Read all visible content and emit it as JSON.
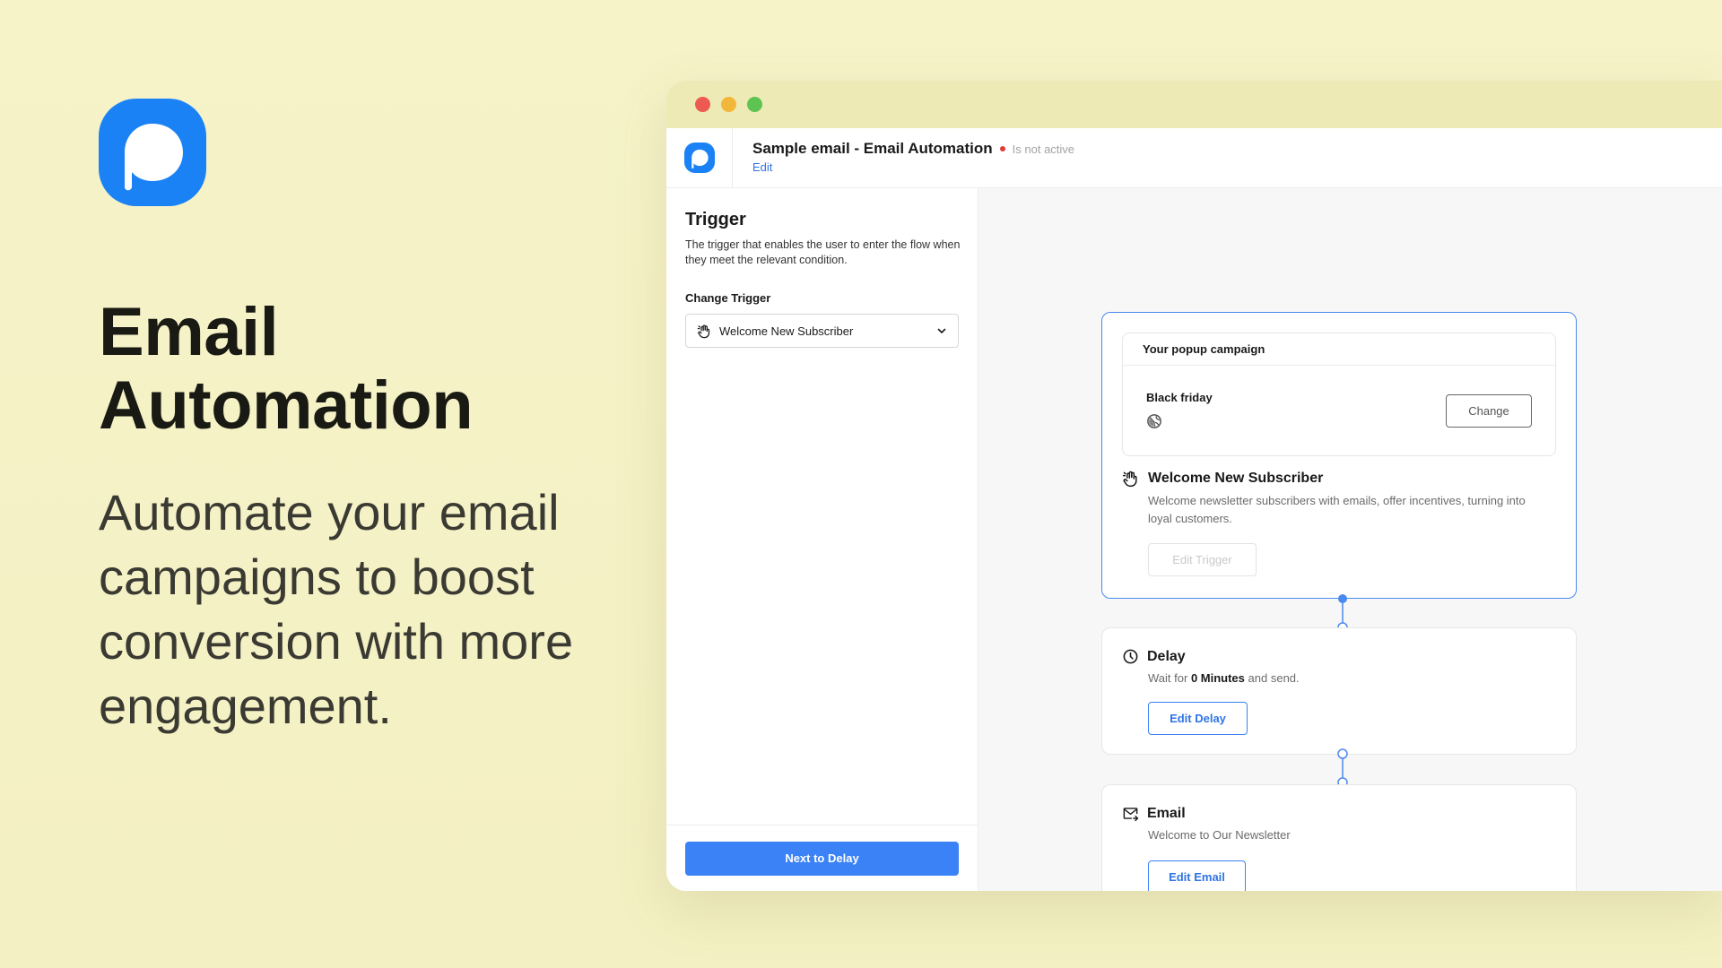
{
  "hero": {
    "title_line1": "Email",
    "title_line2": "Automation",
    "subtitle": "Automate your email campaigns to boost conversion with more engagement."
  },
  "colors": {
    "background": "#f6f3c9",
    "brand_blue": "#1b82f6",
    "accent": "#3b82f6",
    "status_inactive": "#e53935"
  },
  "window": {
    "controls": [
      "close-red",
      "minimize-yellow",
      "maximize-green"
    ]
  },
  "header": {
    "title": "Sample email - Email Automation",
    "status": "Is not active",
    "edit_label": "Edit"
  },
  "sidebar": {
    "title": "Trigger",
    "description": "The trigger that enables the user to enter the flow when they meet the relevant condition.",
    "change_label": "Change Trigger",
    "selected_trigger": "Welcome New Subscriber",
    "next_button": "Next to Delay"
  },
  "flow": {
    "trigger": {
      "popup_header": "Your popup campaign",
      "popup_name": "Black friday",
      "change_button": "Change",
      "title": "Welcome New Subscriber",
      "description": "Welcome newsletter subscribers with emails, offer incentives, turning into loyal customers.",
      "edit_button": "Edit Trigger"
    },
    "delay": {
      "title": "Delay",
      "desc_prefix": "Wait for",
      "desc_value": "0 Minutes",
      "desc_suffix": "and send.",
      "edit_button": "Edit Delay"
    },
    "email": {
      "title": "Email",
      "description": "Welcome to Our Newsletter",
      "edit_button": "Edit Email"
    }
  }
}
